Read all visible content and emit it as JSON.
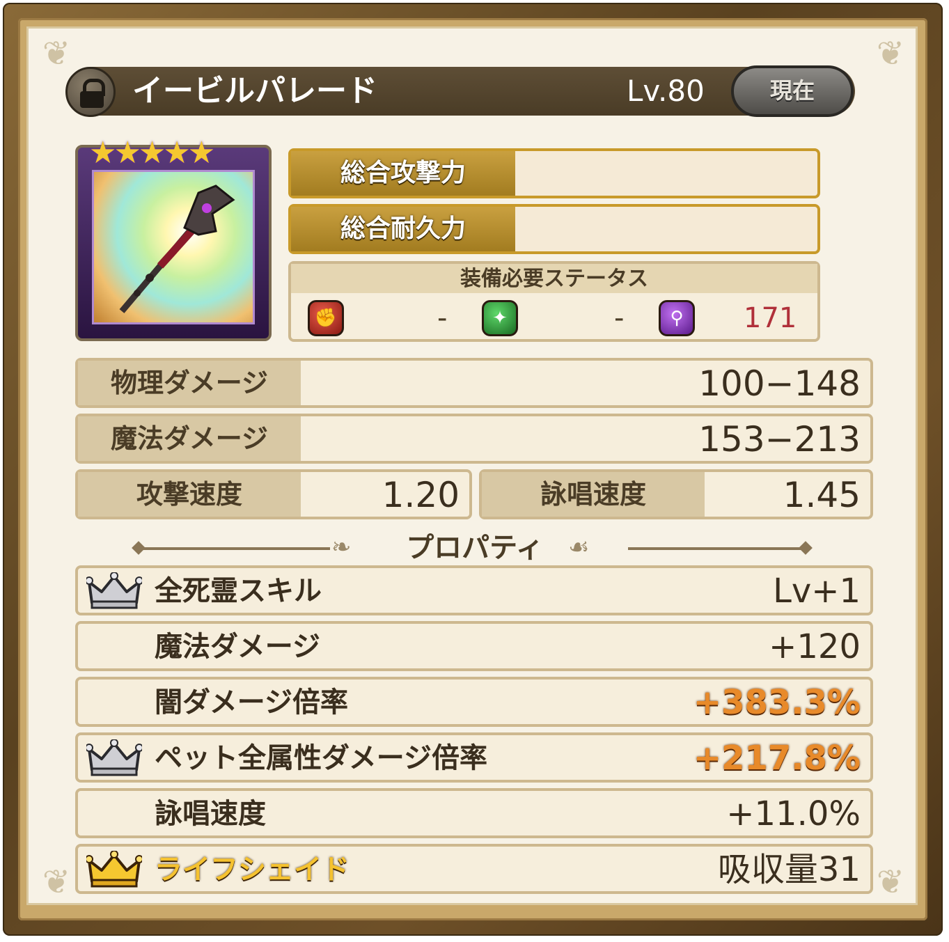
{
  "header": {
    "item_name": "イービルパレード",
    "level": "Lv.80",
    "current_label": "現在"
  },
  "card": {
    "stars": "★★★★★",
    "rarity_stars": 5
  },
  "totals": {
    "attack_label": "総合攻撃力",
    "durability_label": "総合耐久力"
  },
  "requirements": {
    "title": "装備必要ステータス",
    "items": [
      {
        "icon": "fist-icon",
        "value": "-"
      },
      {
        "icon": "sparkle-icon",
        "value": "-"
      },
      {
        "icon": "wand-icon",
        "value": "171"
      }
    ]
  },
  "stats": {
    "physical": {
      "label": "物理ダメージ",
      "value": "100−148"
    },
    "magic": {
      "label": "魔法ダメージ",
      "value": "153−213"
    },
    "attack_speed": {
      "label": "攻撃速度",
      "value": "1.20"
    },
    "cast_speed": {
      "label": "詠唱速度",
      "value": "1.45"
    }
  },
  "properties": {
    "title": "プロパティ",
    "items": [
      {
        "label": "全死霊スキル",
        "value": "Lv+1",
        "crown": "silver-crown-icon"
      },
      {
        "label": "魔法ダメージ",
        "value": "+120"
      },
      {
        "label": "闇ダメージ倍率",
        "value": "+383.3%"
      },
      {
        "label": "ペット全属性ダメージ倍率",
        "value": "+217.8%",
        "crown": "silver-crown-icon"
      },
      {
        "label": "詠唱速度",
        "value": "+11.0%"
      },
      {
        "label": "ライフシェイド",
        "value": "吸収量31",
        "crown": "gold-crown-icon"
      }
    ]
  },
  "colors": {
    "frame": "#6e5028",
    "panel": "#f7f2e6",
    "gold_label": "#c9a040",
    "highlight_value": "#e88a2a",
    "requirement_red": "#b0303a"
  }
}
